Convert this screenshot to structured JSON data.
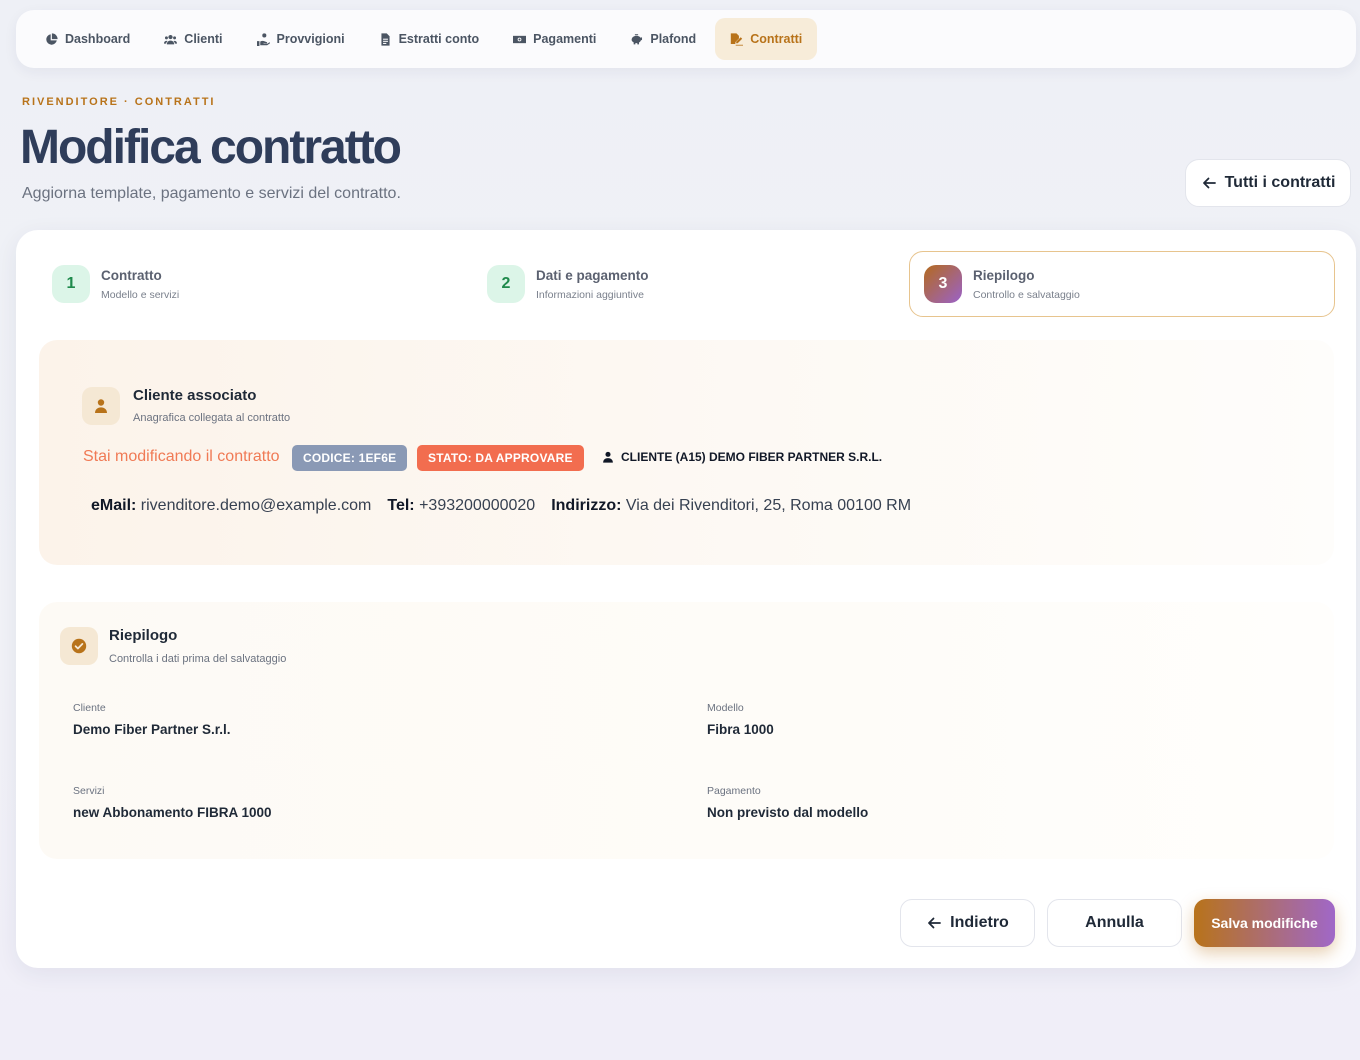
{
  "nav": {
    "items": [
      {
        "label": "Dashboard",
        "icon": "chart-pie-icon"
      },
      {
        "label": "Clienti",
        "icon": "users-icon"
      },
      {
        "label": "Provvigioni",
        "icon": "hand-coins-icon"
      },
      {
        "label": "Estratti conto",
        "icon": "file-invoice-icon"
      },
      {
        "label": "Pagamenti",
        "icon": "money-bill-icon"
      },
      {
        "label": "Plafond",
        "icon": "piggy-bank-icon"
      },
      {
        "label": "Contratti",
        "icon": "file-signature-icon",
        "active": true
      }
    ]
  },
  "header": {
    "eyebrow": "RIVENDITORE · CONTRATTI",
    "title": "Modifica contratto",
    "subtitle": "Aggiorna template, pagamento e servizi del contratto.",
    "back_all_label": "Tutti i contratti"
  },
  "steps": [
    {
      "num": "1",
      "title": "Contratto",
      "desc": "Modello e servizi"
    },
    {
      "num": "2",
      "title": "Dati e pagamento",
      "desc": "Informazioni aggiuntive"
    },
    {
      "num": "3",
      "title": "Riepilogo",
      "desc": "Controllo e salvataggio",
      "active": true
    }
  ],
  "client": {
    "title": "Cliente associato",
    "desc": "Anagrafica collegata al contratto",
    "editing_label": "Stai modificando il contratto",
    "code_badge": "CODICE: 1EF6E",
    "status_badge": "STATO: DA APPROVARE",
    "client_ref": "CLIENTE (A15) DEMO FIBER PARTNER S.R.L.",
    "email_label": "eMail:",
    "email": "rivenditore.demo@example.com",
    "tel_label": "Tel:",
    "tel": "+393200000020",
    "address_label": "Indirizzo:",
    "address": "Via dei Rivenditori, 25, Roma 00100 RM"
  },
  "summary": {
    "title": "Riepilogo",
    "desc": "Controlla i dati prima del salvataggio",
    "fields": {
      "cliente": {
        "label": "Cliente",
        "value": "Demo Fiber Partner S.r.l."
      },
      "modello": {
        "label": "Modello",
        "value": "Fibra 1000"
      },
      "servizi": {
        "label": "Servizi",
        "value": "new Abbonamento FIBRA 1000"
      },
      "pagamento": {
        "label": "Pagamento",
        "value": "Non previsto dal modello"
      }
    }
  },
  "actions": {
    "back": "Indietro",
    "cancel": "Annulla",
    "save": "Salva modifiche"
  },
  "colors": {
    "accent": "#b8731a",
    "status_badge": "#f26d4f",
    "code_badge": "#8a99b5",
    "step_done": "#dcf5e8"
  }
}
